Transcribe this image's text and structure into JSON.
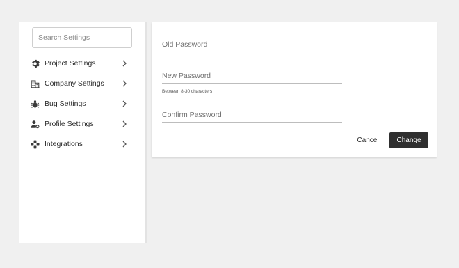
{
  "sidebar": {
    "search": {
      "placeholder": "Search Settings",
      "value": ""
    },
    "items": [
      {
        "label": "Project Settings",
        "icon": "gear-icon"
      },
      {
        "label": "Company Settings",
        "icon": "building-icon"
      },
      {
        "label": "Bug Settings",
        "icon": "bug-icon"
      },
      {
        "label": "Profile Settings",
        "icon": "user-settings-icon"
      },
      {
        "label": "Integrations",
        "icon": "integrations-icon"
      }
    ]
  },
  "form": {
    "old_password": {
      "placeholder": "Old Password",
      "value": ""
    },
    "new_password": {
      "placeholder": "New Password",
      "value": "",
      "helper": "Between 8-30 characters"
    },
    "confirm_password": {
      "placeholder": "Confirm Password",
      "value": ""
    },
    "cancel_label": "Cancel",
    "change_label": "Change"
  },
  "colors": {
    "background": "#f0f0f0",
    "panel": "#ffffff",
    "primary_button": "#2f2f2f",
    "icon": "#3a3a3a"
  }
}
